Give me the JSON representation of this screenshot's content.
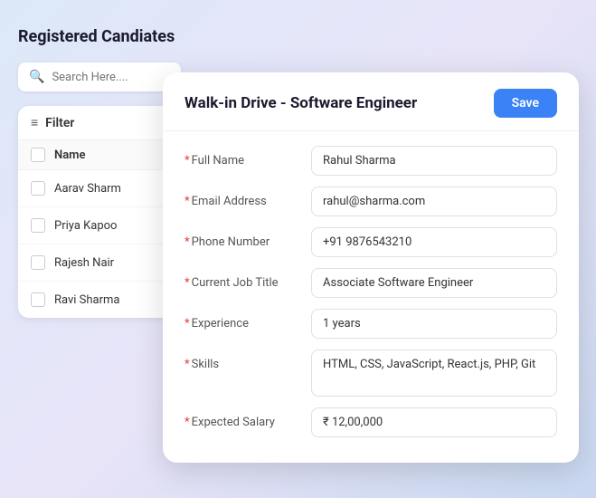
{
  "page": {
    "background": "gradient-blue-purple"
  },
  "left_panel": {
    "title": "Registered Candiates",
    "search": {
      "placeholder": "Search Here...."
    },
    "filter_label": "Filter",
    "name_column": "Name",
    "candidates": [
      {
        "name": "Aarav Sharm"
      },
      {
        "name": "Priya Kapoo"
      },
      {
        "name": "Rajesh Nair"
      },
      {
        "name": "Ravi Sharma"
      }
    ]
  },
  "modal": {
    "title": "Walk-in Drive - Software Engineer",
    "save_button": "Save",
    "fields": [
      {
        "label": "Full Name",
        "value": "Rahul Sharma",
        "required": true,
        "type": "input"
      },
      {
        "label": "Email Address",
        "value": "rahul@sharma.com",
        "required": true,
        "type": "input"
      },
      {
        "label": "Phone Number",
        "value": "+91 9876543210",
        "required": true,
        "type": "input"
      },
      {
        "label": "Current Job Title",
        "value": "Associate Software Engineer",
        "required": true,
        "type": "input"
      },
      {
        "label": "Experience",
        "value": "1 years",
        "required": true,
        "type": "input"
      },
      {
        "label": "Skills",
        "value": "HTML, CSS, JavaScript, React.js, PHP, Git",
        "required": true,
        "type": "textarea"
      },
      {
        "label": "Expected Salary",
        "value": "₹ 12,00,000",
        "required": true,
        "type": "input"
      }
    ]
  }
}
